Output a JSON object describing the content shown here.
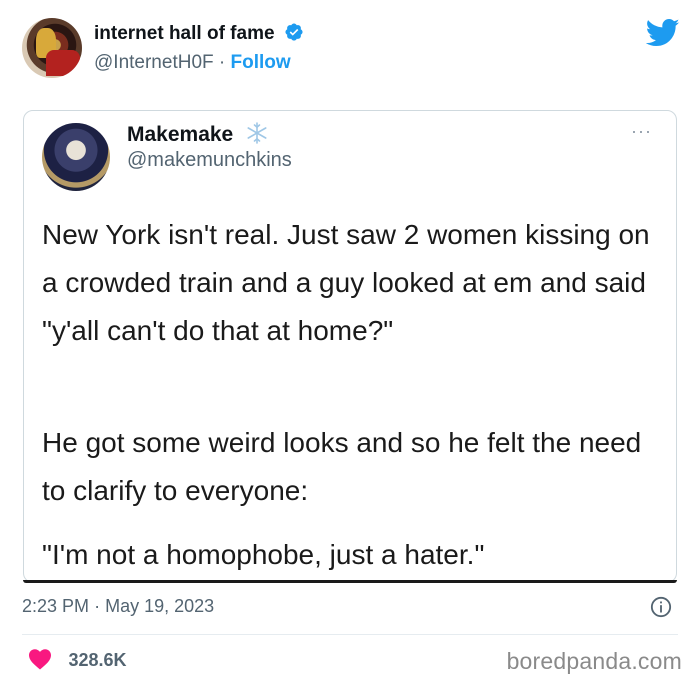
{
  "header": {
    "display_name": "internet hall of fame",
    "handle": "@InternetH0F",
    "separator": "·",
    "follow_label": "Follow",
    "icons": {
      "verified": "verified-badge-icon",
      "platform": "twitter-bird-icon"
    },
    "colors": {
      "accent": "#1d9bf0",
      "text": "#0f1419",
      "secondary": "#536471"
    }
  },
  "embedded_tweet": {
    "display_name": "Makemake",
    "handle": "@makemunchkins",
    "more": "···",
    "icons": {
      "badge": "snowflake-icon"
    },
    "paragraphs": [
      "New York isn't real. Just saw 2 women kissing on a crowded train and a guy looked at em and said \"y'all can't do that at home?\"",
      "He got some weird looks and so he felt the need to clarify to everyone:",
      "\"I'm not a homophobe, just a hater.\""
    ]
  },
  "footer": {
    "time": "2:23 PM",
    "separator": "·",
    "date": "May 19, 2023",
    "likes": "328.6K",
    "watermark": "boredpanda.com",
    "icons": {
      "info": "info-icon",
      "like": "heart-icon"
    },
    "colors": {
      "heart": "#f91880"
    }
  }
}
